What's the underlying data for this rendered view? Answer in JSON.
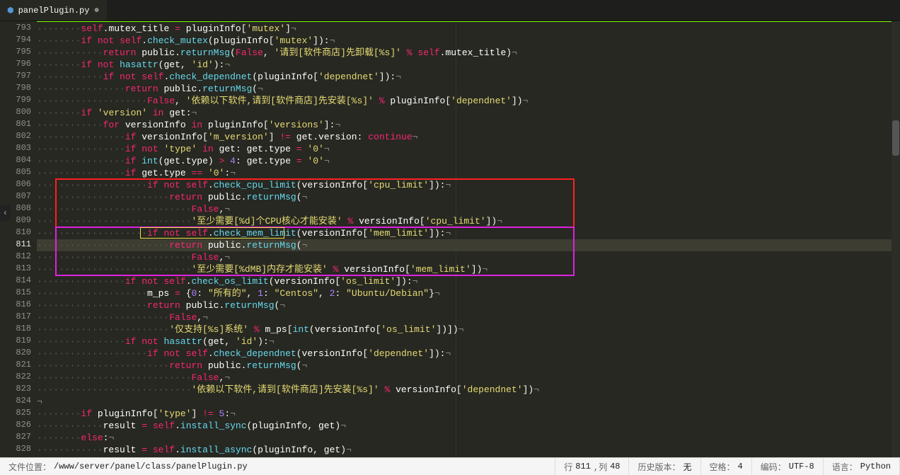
{
  "tab": {
    "filename": "panelPlugin.py",
    "modified": "●"
  },
  "gutter": {
    "start": 793,
    "end": 828,
    "current": 811
  },
  "highlight_boxes": {
    "red": {
      "top_line": 806,
      "bottom_line": 813
    },
    "magenta": {
      "top_line": 810,
      "bottom_line": 813
    },
    "yellow": {
      "line": 810
    }
  },
  "code": {
    "l793": "        self.mutex_title = pluginInfo['mutex']",
    "l794": "        if not self.check_mutex(pluginInfo['mutex']):",
    "l795": "            return public.returnMsg(False, '请到[软件商店]先卸载[%s]' % self.mutex_title)",
    "l796": "        if not hasattr(get, 'id'):",
    "l797": "            if not self.check_dependnet(pluginInfo['dependnet']):",
    "l798": "                return public.returnMsg(",
    "l799": "                    False, '依赖以下软件,请到[软件商店]先安装[%s]' % pluginInfo['dependnet'])",
    "l800": "        if 'version' in get:",
    "l801": "            for versionInfo in pluginInfo['versions']:",
    "l802": "                if versionInfo['m_version'] != get.version: continue",
    "l803": "                if not 'type' in get: get.type = '0'",
    "l804": "                if int(get.type) > 4: get.type = '0'",
    "l805": "                if get.type == '0':",
    "l806": "                    if not self.check_cpu_limit(versionInfo['cpu_limit']):",
    "l807": "                        return public.returnMsg(",
    "l808": "                            False,",
    "l809": "                            '至少需要[%d]个CPU核心才能安装' % versionInfo['cpu_limit'])",
    "l810": "                    if not self.check_mem_limit(versionInfo['mem_limit']):",
    "l811": "                        return public.returnMsg(",
    "l812": "                            False,",
    "l813": "                            '至少需要[%dMB]内存才能安装' % versionInfo['mem_limit'])",
    "l814": "                if not self.check_os_limit(versionInfo['os_limit']):",
    "l815": "                    m_ps = {0: \"所有的\", 1: \"Centos\", 2: \"Ubuntu/Debian\"}",
    "l816": "                    return public.returnMsg(",
    "l817": "                        False,",
    "l818": "                        '仅支持[%s]系统' % m_ps[int(versionInfo['os_limit'])])",
    "l819": "                if not hasattr(get, 'id'):",
    "l820": "                    if not self.check_dependnet(versionInfo['dependnet']):",
    "l821": "                        return public.returnMsg(",
    "l822": "                            False,",
    "l823": "                            '依赖以下软件,请到[软件商店]先安装[%s]' % versionInfo['dependnet'])",
    "l824": "",
    "l825": "        if pluginInfo['type'] != 5:",
    "l826": "            result = self.install_sync(pluginInfo, get)",
    "l827": "        else:",
    "l828": "            result = self.install_async(pluginInfo, get)"
  },
  "status": {
    "file_path_label": "文件位置：",
    "file_path": "/www/server/panel/class/panelPlugin.py",
    "line_col_label": "行",
    "line": "811",
    "col_label": ",列",
    "col": "48",
    "history_label": "历史版本：",
    "history": "无",
    "indent_label": "空格：",
    "indent": "4",
    "encoding_label": "编码：",
    "encoding": "UTF-8",
    "lang_label": "语言：",
    "lang": "Python"
  }
}
